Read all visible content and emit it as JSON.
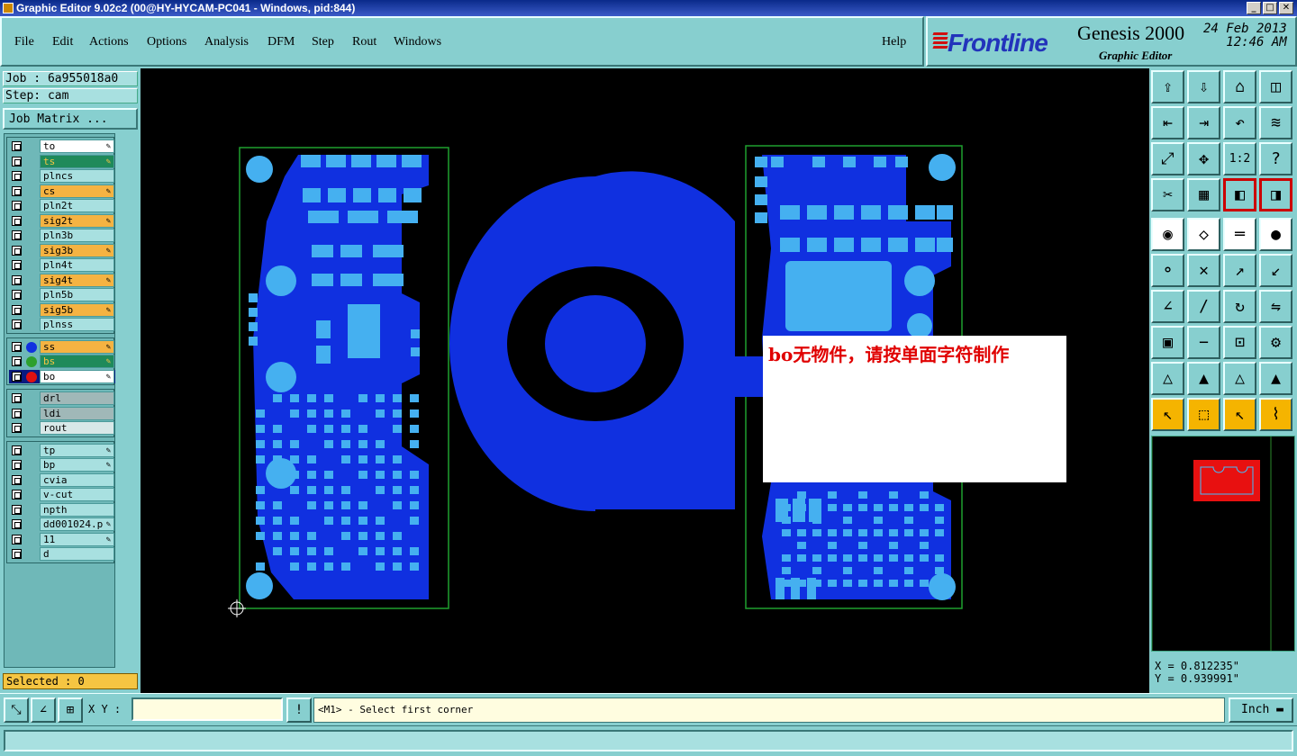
{
  "window": {
    "title": "Graphic Editor 9.02c2 (00@HY-HYCAM-PC041 - Windows, pid:844)"
  },
  "menubar": {
    "items": [
      "File",
      "Edit",
      "Actions",
      "Options",
      "Analysis",
      "DFM",
      "Step",
      "Rout",
      "Windows"
    ],
    "help": "Help"
  },
  "brand": {
    "logo": "Frontline",
    "product": "Genesis 2000",
    "subtitle": "Graphic Editor",
    "date": "24 Feb 2013",
    "time": "12:46 AM"
  },
  "left": {
    "job": "Job : 6a955018a0",
    "step": "Step: cam",
    "job_matrix": "Job Matrix ...",
    "selected": "Selected : 0"
  },
  "layers": [
    {
      "name": "to",
      "color": "#ffffff",
      "edit": true
    },
    {
      "name": "ts",
      "color": "#1f8a5a",
      "edit": true,
      "text_color": "#f5c542"
    },
    {
      "name": "plncs",
      "color": "#a8e0e0"
    },
    {
      "name": "cs",
      "color": "#f5b342",
      "edit": true
    },
    {
      "name": "pln2t",
      "color": "#a8e0e0"
    },
    {
      "name": "sig2t",
      "color": "#f5b342",
      "edit": true
    },
    {
      "name": "pln3b",
      "color": "#a8e0e0"
    },
    {
      "name": "sig3b",
      "color": "#f5b342",
      "edit": true
    },
    {
      "name": "pln4t",
      "color": "#a8e0e0"
    },
    {
      "name": "sig4t",
      "color": "#f5b342",
      "edit": true
    },
    {
      "name": "pln5b",
      "color": "#a8e0e0"
    },
    {
      "name": "sig5b",
      "color": "#f5b342",
      "edit": true
    },
    {
      "name": "plnss",
      "color": "#a8e0e0"
    },
    {
      "name": "ss",
      "color": "#f5b342",
      "edit": true,
      "dot": "#1030e0"
    },
    {
      "name": "bs",
      "color": "#1f8a5a",
      "edit": true,
      "dot": "#2da02d",
      "text_color": "#f5c542"
    },
    {
      "name": "bo",
      "color": "#ffffff",
      "edit": true,
      "dot": "#e01010",
      "active": true
    },
    {
      "name": "drl",
      "color": "#a0b8b8"
    },
    {
      "name": "ldi",
      "color": "#a0b8b8"
    },
    {
      "name": "rout",
      "color": "#d8e8e8"
    },
    {
      "name": "tp",
      "color": "#a8e0e0",
      "edit": true
    },
    {
      "name": "bp",
      "color": "#a8e0e0",
      "edit": true
    },
    {
      "name": "cvia",
      "color": "#a8e0e0"
    },
    {
      "name": "v-cut",
      "color": "#a8e0e0"
    },
    {
      "name": "npth",
      "color": "#a8e0e0"
    },
    {
      "name": "dd001024.p",
      "color": "#a8e0e0",
      "edit": true
    },
    {
      "name": "11",
      "color": "#a8e0e0",
      "edit": true
    },
    {
      "name": "d",
      "color": "#a8e0e0"
    }
  ],
  "canvas": {
    "note": "bo无物件，请按单面字符制作"
  },
  "coords": {
    "x": "X = 0.812235\"",
    "y": "Y = 0.939991\""
  },
  "bottom": {
    "xy_label": "X Y :",
    "xy_value": "",
    "prompt": "<M1> - Select first corner",
    "units": "Inch"
  },
  "colors": {
    "panel": "#87cfcf",
    "board_copper": "#1030e0",
    "pads": "#45b0f0",
    "outline": "#1fa02f",
    "note_text": "#e00000"
  },
  "toolbar_icons": [
    "open-job-icon",
    "save-job-icon",
    "home-icon",
    "window-split-icon",
    "step-left-icon",
    "step-right-icon",
    "undo-icon",
    "zigzag-icon",
    "fit-icon",
    "zoom-center-icon",
    "one-to-one-icon",
    "help-icon",
    "tool-icon",
    "grid-icon",
    "layer-compare-icon",
    "layer-compare2-icon",
    "pad-icon",
    "polygon-icon",
    "ruler-icon",
    "circle-pad-icon",
    "connect-icon",
    "cross-icon",
    "line-icon",
    "arc-icon",
    "angle-icon",
    "slash-icon",
    "rotate-icon",
    "mirror-icon",
    "move-icon",
    "minus-icon",
    "dimension-icon",
    "gear-cluster-icon",
    "triangle-icon",
    "triangle2-icon",
    "triangle3-icon",
    "triangle4-icon",
    "pointer-icon",
    "pointer-box-icon",
    "pointer-select-icon",
    "route-icon"
  ]
}
